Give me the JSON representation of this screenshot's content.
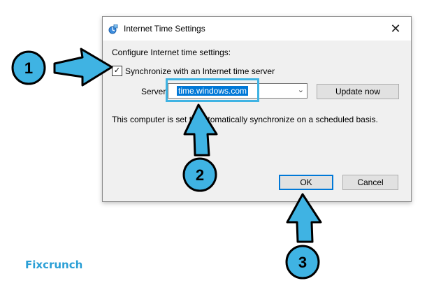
{
  "dialog": {
    "title": "Internet Time Settings",
    "close_glyph": "✕",
    "configure_label": "Configure Internet time settings:",
    "sync_label": "Synchronize with an Internet time server",
    "sync_checked": true,
    "server_label": "Server:",
    "server_value": "time.windows.com",
    "update_button": "Update now",
    "info_text": "This computer is set to automatically synchronize on a scheduled basis.",
    "ok_button": "OK",
    "cancel_button": "Cancel"
  },
  "annotations": {
    "step1": "1",
    "step2": "2",
    "step3": "3",
    "arrow_color": "#3fb3e3"
  },
  "branding": {
    "logo_text": "Fixcrunch"
  }
}
